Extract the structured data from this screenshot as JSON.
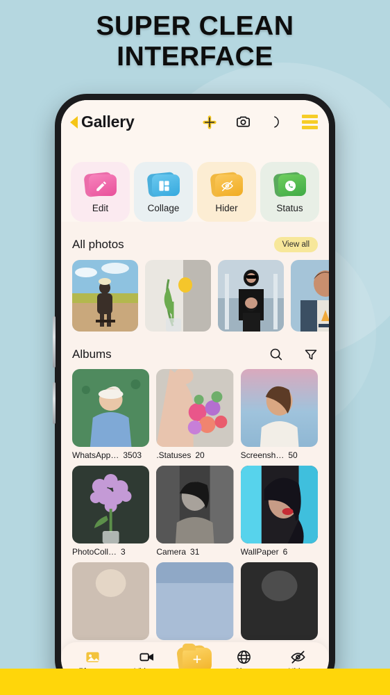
{
  "promo": {
    "headline_line1": "SUPER CLEAN",
    "headline_line2": "INTERFACE",
    "background_color": "#b5d7e0",
    "accent_color": "#ffd60a"
  },
  "appbar": {
    "back_icon": "back-triangle-icon",
    "title": "Gallery",
    "actions": [
      {
        "name": "add-icon",
        "label": "+"
      },
      {
        "name": "camera-icon",
        "label": "Camera"
      },
      {
        "name": "dark-mode-moon-icon",
        "label": "Dark mode"
      },
      {
        "name": "hamburger-menu-icon",
        "label": "Menu"
      }
    ]
  },
  "tiles": [
    {
      "label": "Edit",
      "icon": "pencil-folder-icon",
      "bg": "#fbeaf0",
      "folder": "#ef6fae"
    },
    {
      "label": "Collage",
      "icon": "collage-folder-icon",
      "bg": "#e9f0f2",
      "folder": "#4cb9e7"
    },
    {
      "label": "Hider",
      "icon": "eye-slash-folder-icon",
      "bg": "#fcedd3",
      "folder": "#f5b942"
    },
    {
      "label": "Status",
      "icon": "whatsapp-folder-icon",
      "bg": "#e8efe6",
      "folder": "#4caf50"
    }
  ],
  "all_photos": {
    "title": "All photos",
    "view_all_label": "View all",
    "thumbnails": [
      {
        "name": "photo-woman-on-chair"
      },
      {
        "name": "photo-yellow-tulip"
      },
      {
        "name": "photo-two-women-black"
      },
      {
        "name": "photo-boy-denim-jacket"
      }
    ]
  },
  "albums": {
    "title": "Albums",
    "search_icon": "search-icon",
    "filter_icon": "filter-funnel-icon",
    "items": [
      {
        "name": "WhatsApp…",
        "count": "3503",
        "thumb": "album-woman-grass"
      },
      {
        "name": ".Statuses",
        "count": "20",
        "thumb": "album-woman-flowers"
      },
      {
        "name": "Screensh…",
        "count": "50",
        "thumb": "album-woman-sunset"
      },
      {
        "name": "PhotoColl…",
        "count": "3",
        "thumb": "album-lilac-flowers"
      },
      {
        "name": "Camera",
        "count": "31",
        "thumb": "album-bw-portrait"
      },
      {
        "name": "WallPaper",
        "count": "6",
        "thumb": "album-cyan-portrait"
      }
    ]
  },
  "bottom_nav": {
    "items": [
      {
        "label": "Photos",
        "icon": "photos-icon",
        "active": true
      },
      {
        "label": "Videos",
        "icon": "video-camera-icon",
        "active": false
      },
      {
        "label": "Sites",
        "icon": "globe-icon",
        "active": false
      },
      {
        "label": "Hider",
        "icon": "eye-slash-icon",
        "active": false
      }
    ],
    "fab": {
      "name": "add-folder-fab",
      "label": "+"
    }
  }
}
